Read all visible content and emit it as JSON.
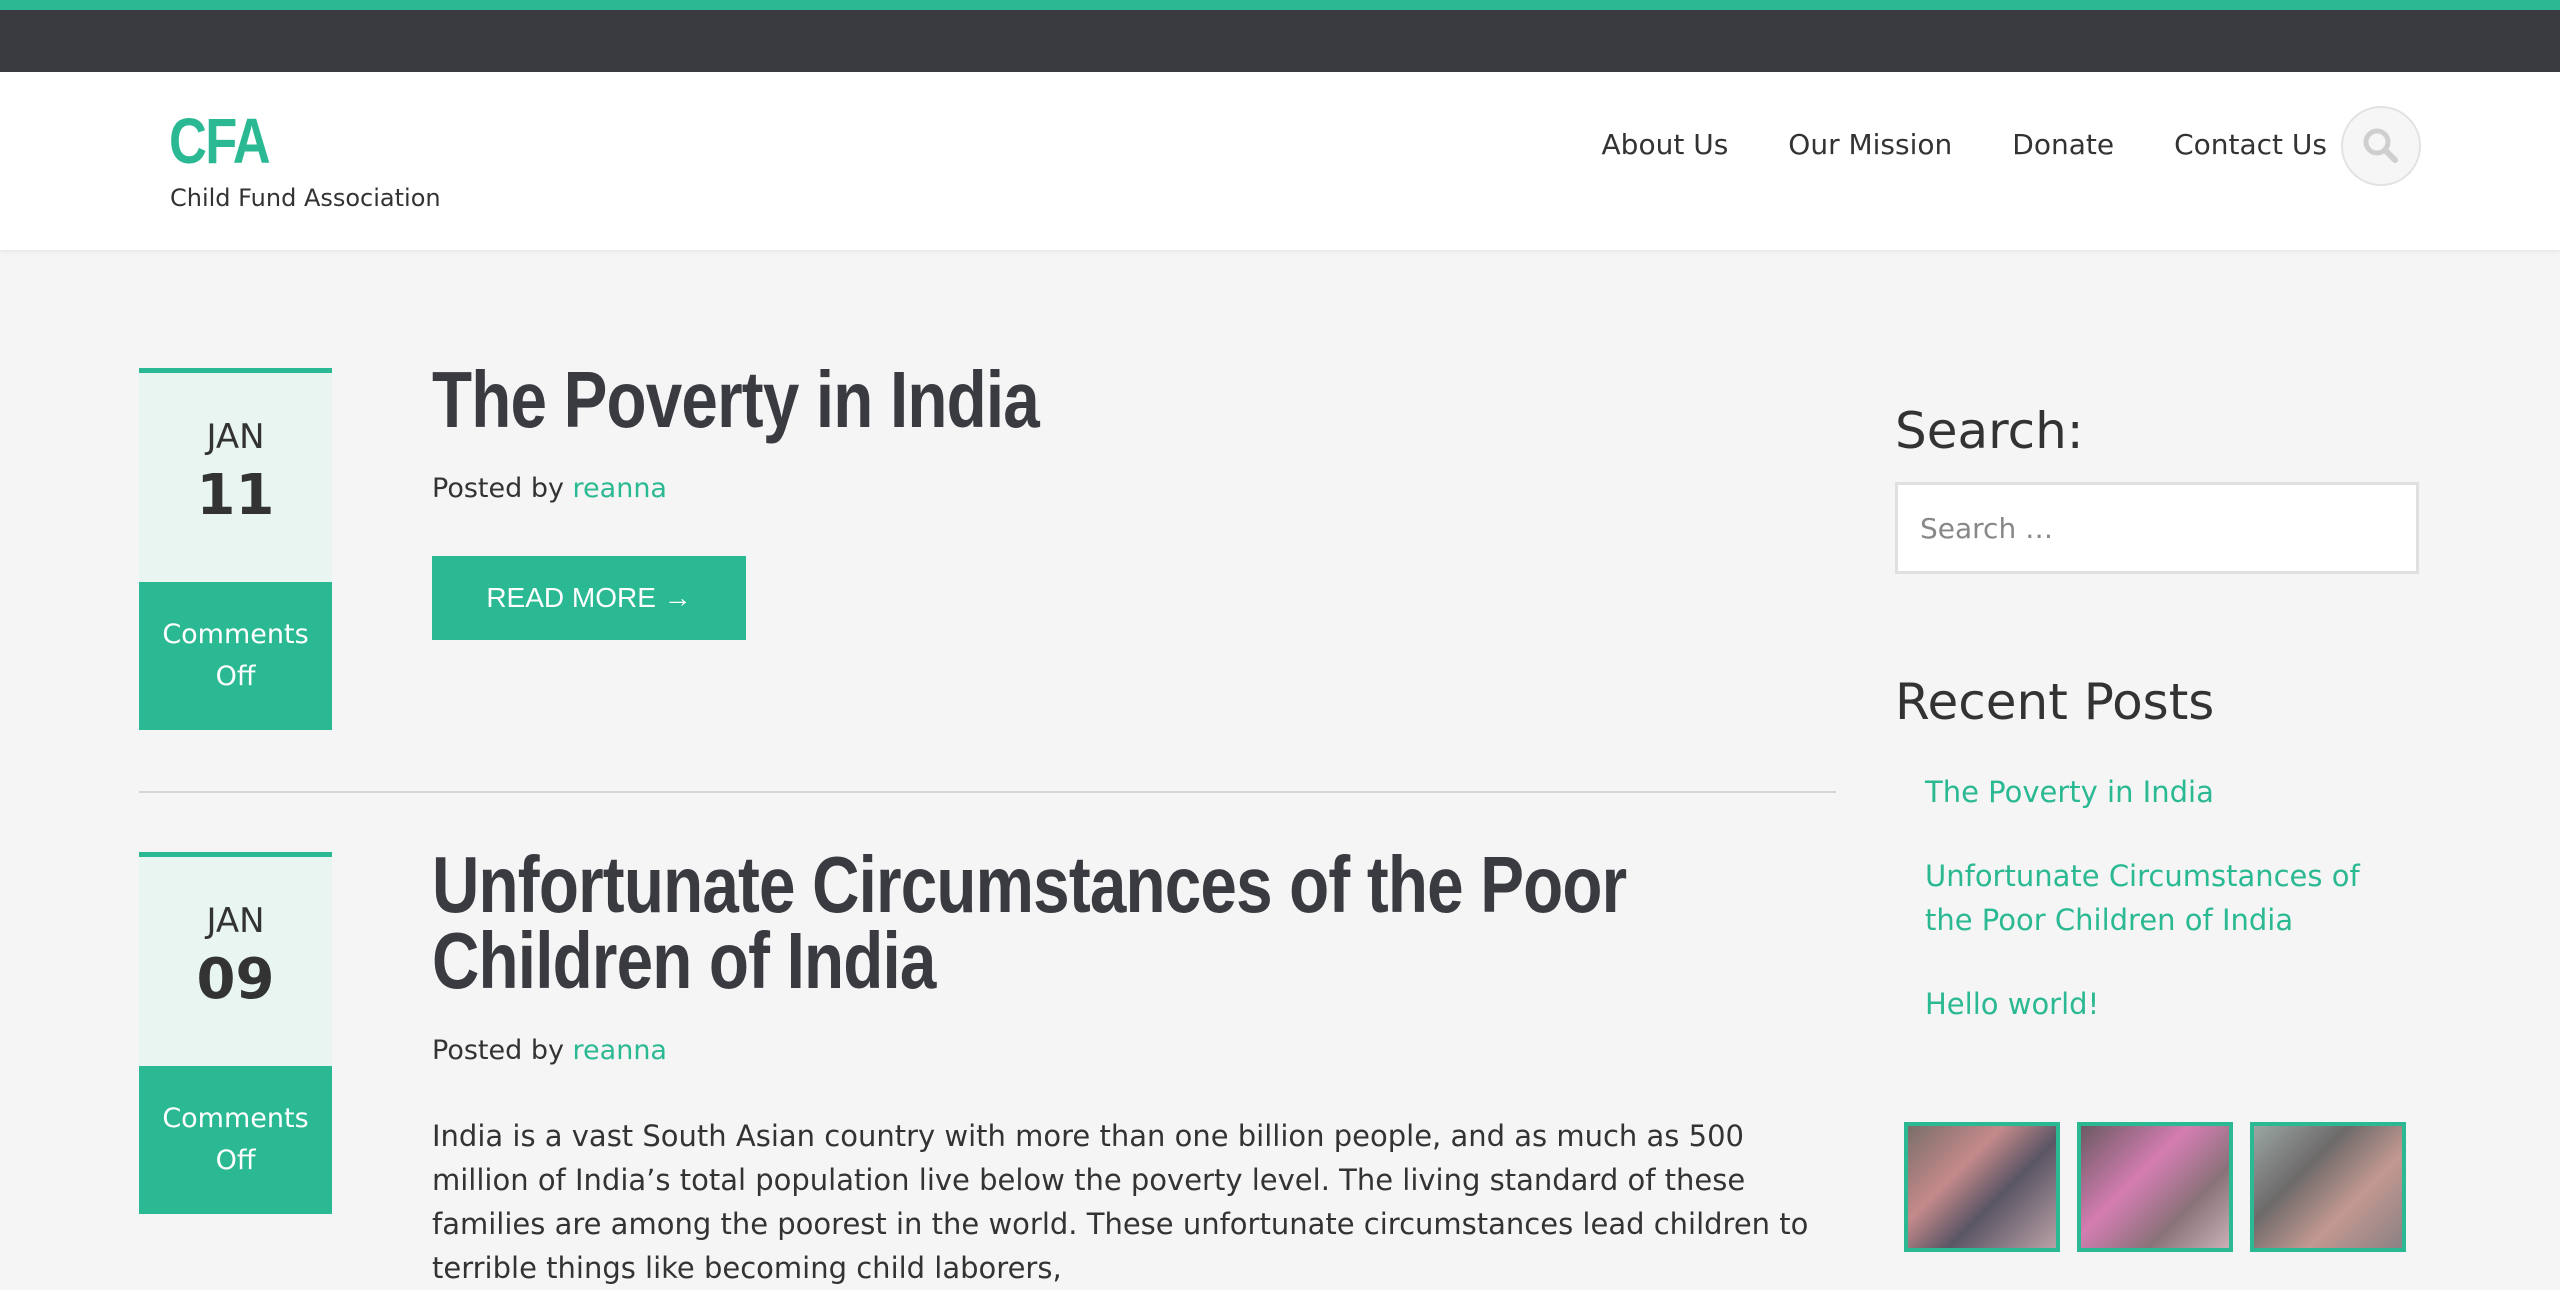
{
  "site": {
    "logo": "CFA",
    "tagline": "Child Fund Association"
  },
  "nav": {
    "items": [
      "About Us",
      "Our Mission",
      "Donate",
      "Contact Us"
    ]
  },
  "posts": [
    {
      "month": "JAN",
      "day": "11",
      "comments": "Comments Off",
      "title": "The Poverty in India",
      "posted_by": "Posted by",
      "author": "reanna",
      "read_more": "READ MORE →"
    },
    {
      "month": "JAN",
      "day": "09",
      "comments": "Comments Off",
      "title_line1": "Unfortunate Circumstances of the Poor",
      "title_line2": "Children of India",
      "posted_by": "Posted by",
      "author": "reanna",
      "excerpt": "India is a vast South Asian country with more than one billion people, and as much as 500 million of India’s total population live below the poverty level. The living standard of these families are among the poorest in the world. These unfortunate circumstances lead children to terrible things like becoming child laborers,"
    }
  ],
  "sidebar": {
    "search_heading": "Search:",
    "search_placeholder": "Search …",
    "recent_heading": "Recent Posts",
    "recent_posts": [
      "The Poverty in India",
      "Unfortunate Circumstances of the Poor Children of India",
      "Hello world!"
    ]
  },
  "colors": {
    "accent": "#2bb993",
    "topbar": "#3a3b41",
    "date_bg": "#e9f5f1"
  }
}
